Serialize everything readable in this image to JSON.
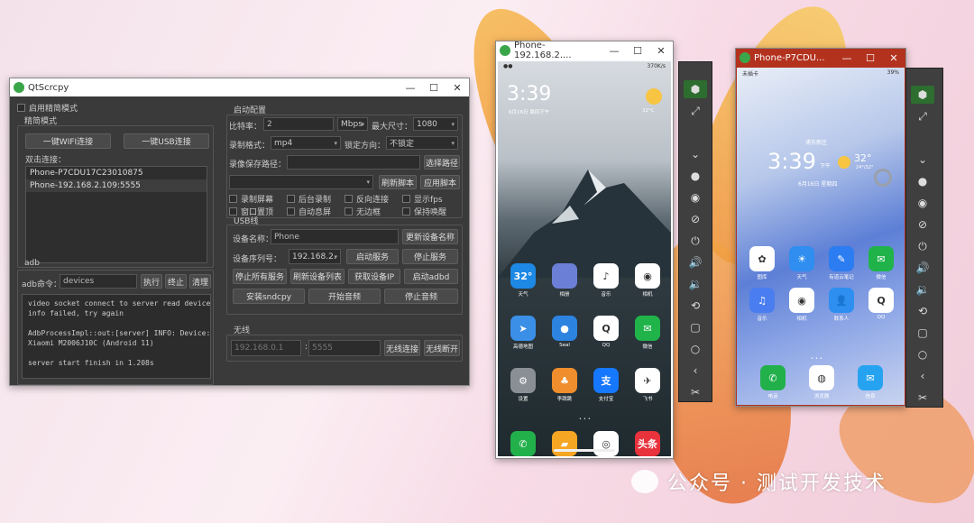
{
  "main_window": {
    "title": "QtScrcpy",
    "simple_mode_checkbox": "启用精简模式",
    "simple_group_title": "精简模式",
    "wifi_connect_button": "一键WIFI连接",
    "usb_connect_button": "一键USB连接",
    "dual_connect_label": "双击连接：",
    "devices": [
      "Phone-P7CDU17C23010875",
      "Phone-192.168.2.109:5555"
    ],
    "adb_group_title": "adb",
    "adb_cmd_label": "adb命令：",
    "adb_cmd_value": "devices",
    "execute_button": "执行",
    "stop_button": "终止",
    "clear_button": "清理",
    "log_lines": [
      "video socket connect to server read device",
      "info failed, try again",
      "",
      "AdbProcessImpl::out:[server] INFO: Device:",
      "Xiaomi M2006J10C (Android 11)",
      "",
      "server start finish in 1.208s"
    ],
    "config_group_title": "启动配置",
    "bitrate_label": "比特率：",
    "bitrate_value": "2",
    "bitrate_unit": "Mbps",
    "max_size_label": "最大尺寸：",
    "max_size_value": "1080",
    "record_format_label": "录制格式：",
    "record_format_value": "mp4",
    "lock_orientation_label": "锁定方向：",
    "lock_orientation_value": "不锁定",
    "record_path_label": "录像保存路径：",
    "record_path_value": "",
    "select_path_button": "选择路径",
    "script_value": "",
    "refresh_script_button": "刷新脚本",
    "apply_script_button": "应用脚本",
    "checkboxes": [
      "录制屏幕",
      "后台录制",
      "反向连接",
      "显示fps",
      "窗口置顶",
      "自动息屏",
      "无边框",
      "保持唤醒"
    ],
    "usb_group_title": "USB线",
    "device_name_label": "设备名称：",
    "device_name_value": "Phone",
    "update_name_button": "更新设备名称",
    "serial_label": "设备序列号：",
    "serial_value": "192.168.2.",
    "start_service_button": "启动服务",
    "stop_service_button": "停止服务",
    "stop_all_button": "停止所有服务",
    "refresh_devices_button": "刷新设备列表",
    "get_ip_button": "获取设备IP",
    "start_adbd_button": "启动adbd",
    "install_sndcpy_button": "安装sndcpy",
    "start_audio_button": "开始音频",
    "stop_audio_button": "停止音频",
    "wireless_group_title": "无线",
    "ip_placeholder": "192.168.0.1",
    "port_placeholder": "5555",
    "wireless_connect_button": "无线连接",
    "wireless_disconnect_button": "无线断开"
  },
  "phone1": {
    "title": "Phone-192.168.2....",
    "status_right": "370K/s",
    "time": "3:39",
    "date": "6月16日 周四下午",
    "temp": "32°C",
    "apps": [
      {
        "name": "天气",
        "glyph": "32°",
        "color": "#1e88e5"
      },
      {
        "name": "相册",
        "glyph": "",
        "color": "#6b7fd7"
      },
      {
        "name": "音乐",
        "glyph": "♪",
        "color": "#ffffff"
      },
      {
        "name": "相机",
        "glyph": "◉",
        "color": "#ffffff"
      },
      {
        "name": "高德地图",
        "glyph": "➤",
        "color": "#3b8fe6"
      },
      {
        "name": "Seal",
        "glyph": "●",
        "color": "#2d83e0"
      },
      {
        "name": "QQ",
        "glyph": "Q",
        "color": "#ffffff"
      },
      {
        "name": "微信",
        "glyph": "✉",
        "color": "#20b34a"
      },
      {
        "name": "设置",
        "glyph": "⚙",
        "color": "#8a8f96"
      },
      {
        "name": "李跳跳",
        "glyph": "♣",
        "color": "#f08d2c"
      },
      {
        "name": "支付宝",
        "glyph": "支",
        "color": "#1677ff"
      },
      {
        "name": "飞书",
        "glyph": "✈",
        "color": "#ffffff"
      },
      {
        "name": "",
        "glyph": "✆",
        "color": "#22b04b"
      },
      {
        "name": "",
        "glyph": "▰",
        "color": "#f5a623"
      },
      {
        "name": "",
        "glyph": "◎",
        "color": "#ffffff"
      },
      {
        "name": "",
        "glyph": "头条",
        "color": "#e8323c"
      }
    ]
  },
  "phone2": {
    "title": "Phone-P7CDU...",
    "carrier": "未插卡",
    "status_right": "39%",
    "location": "浦东新区",
    "time": "3:39",
    "ampm": "下午",
    "date": "6月16日 星期四",
    "temp": "32°",
    "temp_range": "24°/32°",
    "apps": [
      {
        "name": "图库",
        "glyph": "✿",
        "color": "#ffffff"
      },
      {
        "name": "天气",
        "glyph": "☀",
        "color": "#2f8ef0"
      },
      {
        "name": "有道云笔记",
        "glyph": "✎",
        "color": "#2c7cf2"
      },
      {
        "name": "微信",
        "glyph": "✉",
        "color": "#20b34a"
      },
      {
        "name": "音乐",
        "glyph": "♫",
        "color": "#4a7df0"
      },
      {
        "name": "相机",
        "glyph": "◉",
        "color": "#ffffff"
      },
      {
        "name": "联系人",
        "glyph": "👤",
        "color": "#2e8ff0"
      },
      {
        "name": "QQ",
        "glyph": "Q",
        "color": "#ffffff"
      },
      {
        "name": "电话",
        "glyph": "✆",
        "color": "#22b04b"
      },
      {
        "name": "浏览器",
        "glyph": "◍",
        "color": "#ffffff"
      },
      {
        "name": "信息",
        "glyph": "✉",
        "color": "#26a3f0"
      }
    ]
  },
  "toolbar_icons": [
    "android-icon",
    "fullscreen-icon",
    "chevron-down-icon",
    "dot-icon",
    "eye-icon",
    "eye-off-icon",
    "power-icon",
    "volume-up-icon",
    "volume-down-icon",
    "rotate-icon",
    "square-icon",
    "home-icon",
    "back-icon",
    "scissors-icon"
  ],
  "watermark": "公众号 · 测试开发技术"
}
